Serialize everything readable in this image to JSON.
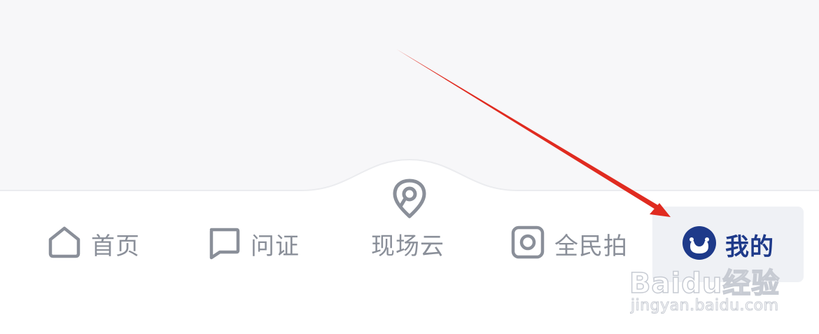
{
  "tab_bar": {
    "tabs": [
      {
        "label": "首页",
        "icon": "home-icon",
        "active": false
      },
      {
        "label": "问证",
        "icon": "chat-bubble-icon",
        "active": false
      },
      {
        "label": "现场云",
        "icon": "location-pin-icon",
        "active": false
      },
      {
        "label": "全民拍",
        "icon": "camera-icon",
        "active": false
      },
      {
        "label": "我的",
        "icon": "avatar-icon",
        "active": true
      }
    ]
  },
  "colors": {
    "inactive": "#8a8f99",
    "active": "#1e3a8a",
    "active_bg": "#eff1f5",
    "annotation_arrow": "#e02b20"
  },
  "watermark": {
    "brand": "Baidu经验",
    "url": "jingyan.baidu.com"
  }
}
